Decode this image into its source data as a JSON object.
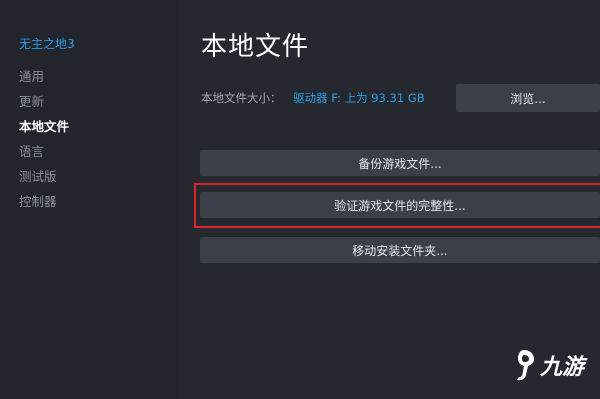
{
  "sidebar": {
    "game_title": "无主之地3",
    "items": [
      {
        "label": "通用"
      },
      {
        "label": "更新"
      },
      {
        "label": "本地文件",
        "active": true
      },
      {
        "label": "语言"
      },
      {
        "label": "测试版"
      },
      {
        "label": "控制器"
      }
    ]
  },
  "main": {
    "title": "本地文件",
    "size_label": "本地文件大小：",
    "size_value": "驱动器 F: 上为 93.31 GB",
    "browse_label": "浏览...",
    "backup_label": "备份游戏文件...",
    "verify_label": "验证游戏文件的完整性...",
    "move_label": "移动安装文件夹..."
  },
  "watermark": {
    "text": "九游"
  },
  "colors": {
    "accent": "#2a9fe6",
    "highlight": "#d9252a",
    "button_bg": "#3b3f47",
    "sidebar_bg": "#22252b",
    "main_bg": "#25282e"
  }
}
